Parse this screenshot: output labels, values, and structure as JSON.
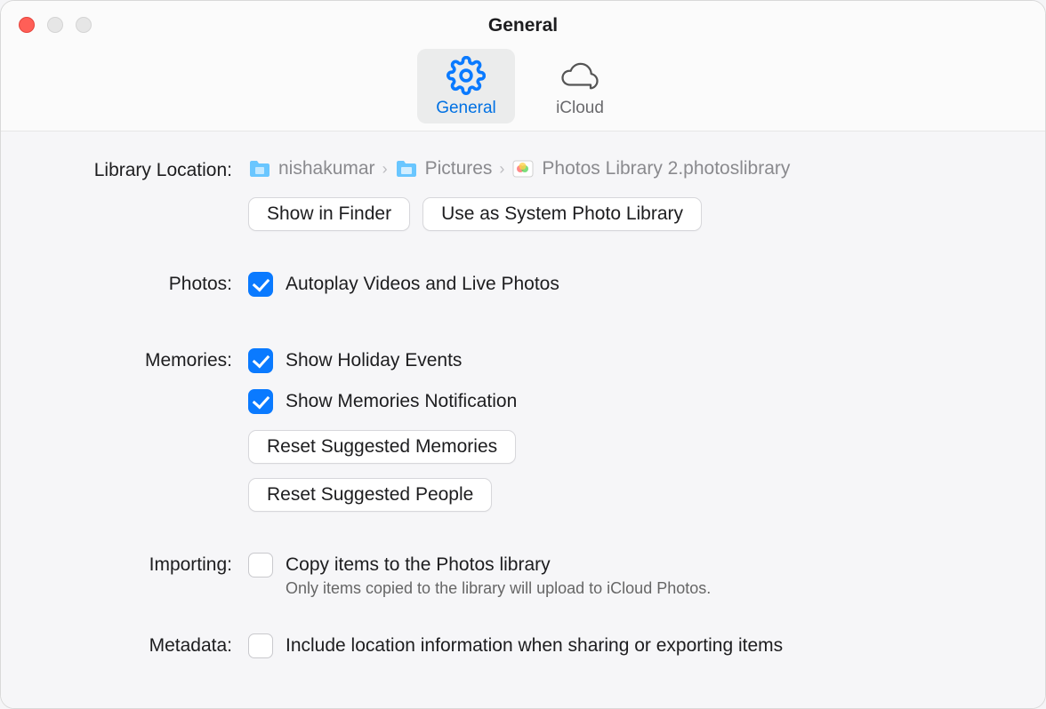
{
  "window": {
    "title": "General"
  },
  "tabs": {
    "general": "General",
    "icloud": "iCloud"
  },
  "library": {
    "label": "Library Location:",
    "path": [
      "nishakumar",
      "Pictures",
      "Photos Library 2.photoslibrary"
    ],
    "show_in_finder": "Show in Finder",
    "use_system": "Use as System Photo Library"
  },
  "photos": {
    "label": "Photos:",
    "autoplay": "Autoplay Videos and Live Photos"
  },
  "memories": {
    "label": "Memories:",
    "holiday": "Show Holiday Events",
    "notification": "Show Memories Notification",
    "reset_memories": "Reset Suggested Memories",
    "reset_people": "Reset Suggested People"
  },
  "importing": {
    "label": "Importing:",
    "copy": "Copy items to the Photos library",
    "note": "Only items copied to the library will upload to iCloud Photos."
  },
  "metadata": {
    "label": "Metadata:",
    "include_location": "Include location information when sharing or exporting items"
  }
}
